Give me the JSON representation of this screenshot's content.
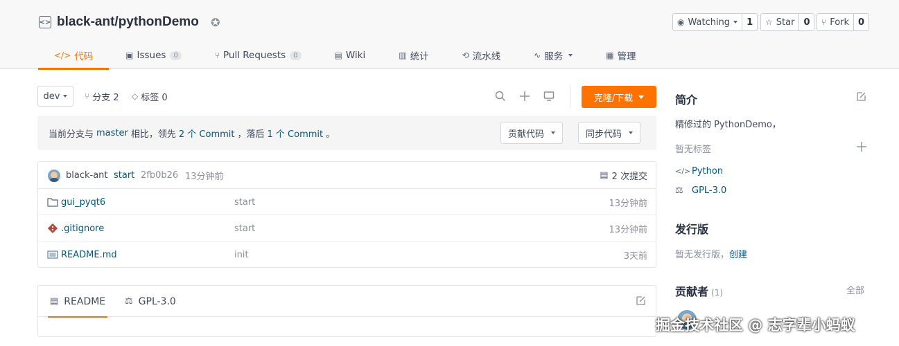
{
  "repo": {
    "name": "black-ant/pythonDemo"
  },
  "header_actions": {
    "watch_label": "Watching",
    "watch_count": "1",
    "star_label": "Star",
    "star_count": "0",
    "fork_label": "Fork",
    "fork_count": "0"
  },
  "tabs": [
    {
      "label": "代码",
      "icon": "code-icon"
    },
    {
      "label": "Issues",
      "badge": "0",
      "icon": "issues-icon"
    },
    {
      "label": "Pull Requests",
      "badge": "0",
      "icon": "pull-request-icon"
    },
    {
      "label": "Wiki",
      "icon": "wiki-icon"
    },
    {
      "label": "统计",
      "icon": "stats-icon"
    },
    {
      "label": "流水线",
      "icon": "pipeline-icon"
    },
    {
      "label": "服务",
      "icon": "service-icon"
    },
    {
      "label": "管理",
      "icon": "manage-icon"
    }
  ],
  "branch_bar": {
    "branch": "dev",
    "branches_label": "分支 2",
    "tags_label": "标签 0",
    "clone_label": "克隆/下载"
  },
  "compare": {
    "prefix": "当前分支与",
    "base": "master",
    "middle1": "相比，领先",
    "ahead": "2 个 Commit",
    "middle2": "，落后",
    "behind": "1 个 Commit",
    "suffix": "。",
    "contribute_label": "贡献代码",
    "sync_label": "同步代码"
  },
  "last_commit": {
    "author": "black-ant",
    "message": "start",
    "hash": "2fb0b26",
    "time": "13分钟前",
    "commits_label": "2 次提交"
  },
  "files": [
    {
      "name": "gui_pyqt6",
      "type": "folder",
      "icon": "folder-icon",
      "message": "start",
      "time": "13分钟前"
    },
    {
      "name": ".gitignore",
      "type": "git",
      "icon": "git-icon",
      "message": "start",
      "time": "13分钟前"
    },
    {
      "name": "README.md",
      "type": "readme",
      "icon": "readme-icon",
      "message": "init",
      "time": "3天前"
    }
  ],
  "readme_tabs": [
    {
      "label": "README",
      "icon": "document-icon"
    },
    {
      "label": "GPL-3.0",
      "icon": "license-icon"
    }
  ],
  "sidebar": {
    "intro_title": "简介",
    "description": "精修过的 PythonDemo，",
    "no_tags": "暂无标签",
    "language": "Python",
    "license": "GPL-3.0",
    "releases_title": "发行版",
    "no_releases": "暂无发行版，",
    "create_label": "创建",
    "contributors_title": "贡献者",
    "contributors_count": "(1)",
    "all_label": "全部"
  },
  "watermark": "掘金技术社区 @ 志字辈小蚂蚁",
  "colors": {
    "accent": "#fe7300",
    "link": "#005980"
  }
}
